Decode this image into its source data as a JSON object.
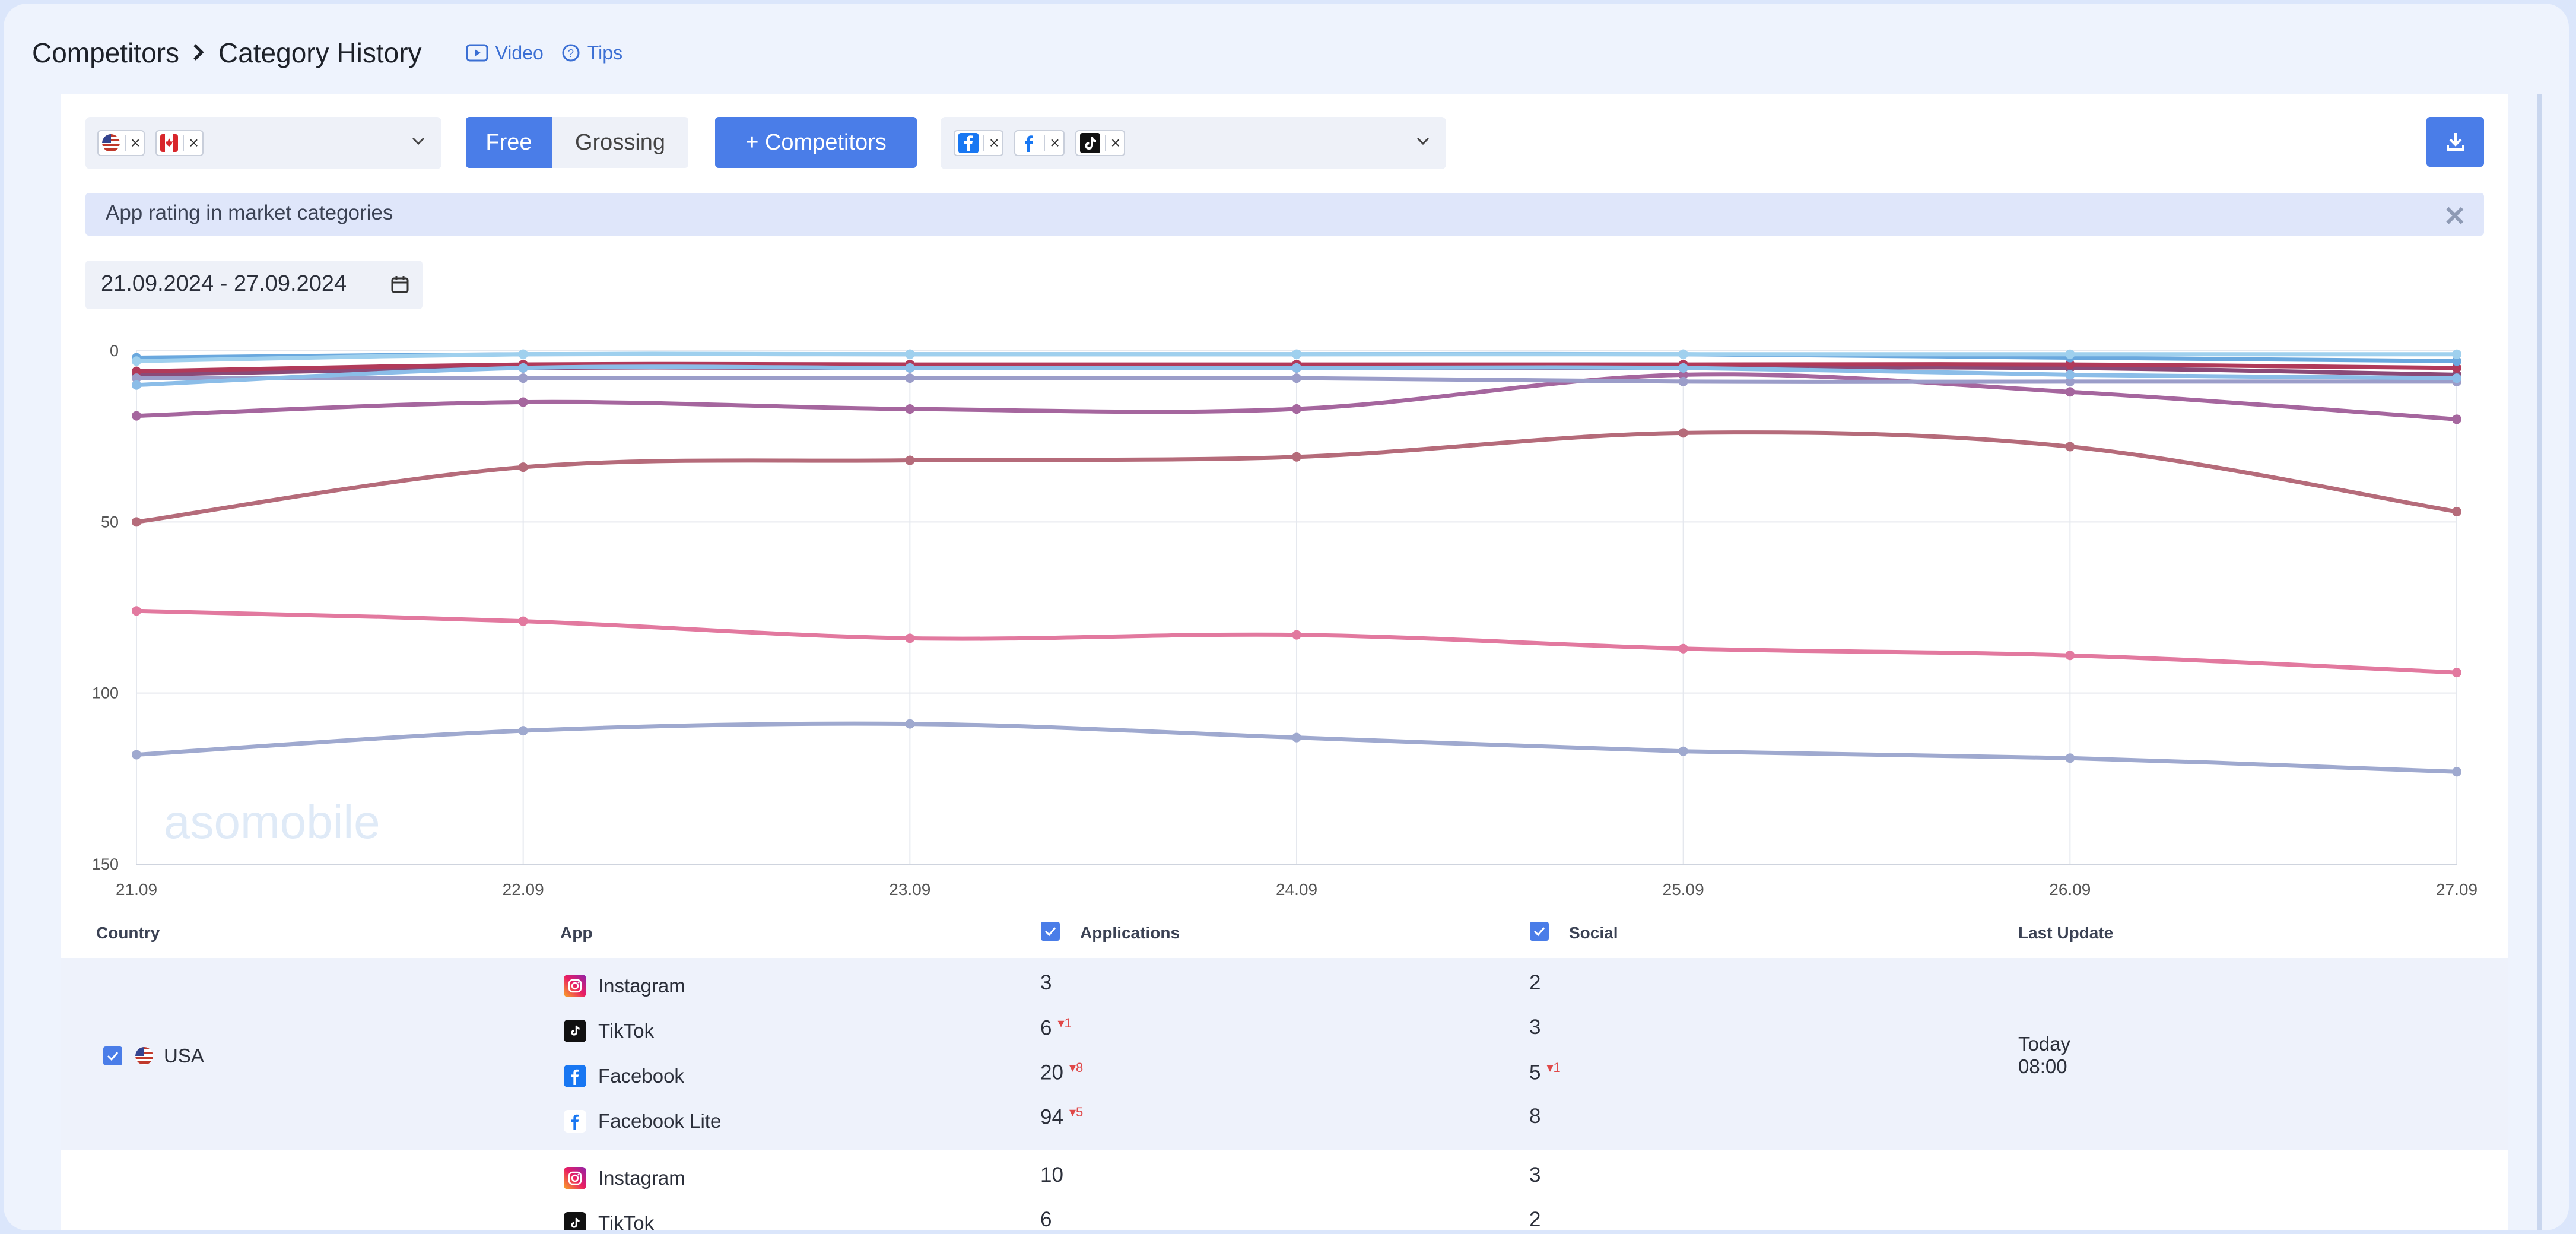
{
  "header": {
    "breadcrumb_parent": "Competitors",
    "breadcrumb_current": "Category History",
    "video_label": "Video",
    "tips_label": "Tips"
  },
  "toolbar": {
    "free_label": "Free",
    "grossing_label": "Grossing",
    "competitors_label": "+ Competitors",
    "chip_remove": "×"
  },
  "info_bar": {
    "text": "App rating in market categories",
    "close_icon": "✕"
  },
  "date_range": "21.09.2024 - 27.09.2024",
  "watermark": "asomobile",
  "chart_data": {
    "type": "line",
    "categories": [
      "21.09",
      "22.09",
      "23.09",
      "24.09",
      "25.09",
      "26.09",
      "27.09"
    ],
    "y_ticks": [
      "0",
      "50",
      "100",
      "150"
    ],
    "ylim": [
      150,
      0
    ],
    "y_inverted": true,
    "grid": true,
    "series": [
      {
        "color": "#9fa9cf",
        "values": [
          118,
          111,
          109,
          113,
          117,
          119,
          123
        ]
      },
      {
        "color": "#e2799f",
        "values": [
          76,
          79,
          84,
          83,
          87,
          89,
          94
        ]
      },
      {
        "color": "#b56b7a",
        "values": [
          50,
          34,
          32,
          31,
          24,
          28,
          47
        ]
      },
      {
        "color": "#a5669e",
        "values": [
          19,
          15,
          17,
          17,
          7,
          12,
          20
        ]
      },
      {
        "color": "#8a4a78",
        "values": [
          7,
          5,
          5,
          5,
          5,
          5,
          7
        ]
      },
      {
        "color": "#b13a5a",
        "values": [
          6,
          4,
          4,
          4,
          4,
          4,
          5
        ]
      },
      {
        "color": "#9b9dc9",
        "values": [
          8,
          8,
          8,
          8,
          9,
          9,
          9
        ]
      },
      {
        "color": "#8bbde8",
        "values": [
          10,
          5,
          5,
          5,
          5,
          7,
          8
        ]
      },
      {
        "color": "#6aa8de",
        "values": [
          2,
          1,
          1,
          1,
          1,
          2,
          3
        ]
      },
      {
        "color": "#9fd0ee",
        "values": [
          3,
          1,
          1,
          1,
          1,
          1,
          1
        ]
      }
    ]
  },
  "table": {
    "headers": {
      "country": "Country",
      "app": "App",
      "applications": "Applications",
      "social": "Social",
      "last_update": "Last Update"
    },
    "groups": [
      {
        "country": "USA",
        "last_update_day": "Today",
        "last_update_time": "08:00",
        "rows": [
          {
            "app": "Instagram",
            "icon": "instagram-icon",
            "applications": "3",
            "app_change": "",
            "social": "2",
            "social_change": ""
          },
          {
            "app": "TikTok",
            "icon": "tiktok-icon",
            "applications": "6",
            "app_change": "▾1",
            "social": "3",
            "social_change": ""
          },
          {
            "app": "Facebook",
            "icon": "facebook-icon",
            "applications": "20",
            "app_change": "▾8",
            "social": "5",
            "social_change": "▾1"
          },
          {
            "app": "Facebook Lite",
            "icon": "facebook-lite-icon",
            "applications": "94",
            "app_change": "▾5",
            "social": "8",
            "social_change": ""
          }
        ]
      },
      {
        "country": "",
        "rows": [
          {
            "app": "Instagram",
            "icon": "instagram-icon",
            "applications": "10",
            "social": "3"
          },
          {
            "app": "TikTok",
            "icon": "tiktok-icon",
            "applications": "6",
            "social": "2"
          }
        ]
      }
    ]
  }
}
